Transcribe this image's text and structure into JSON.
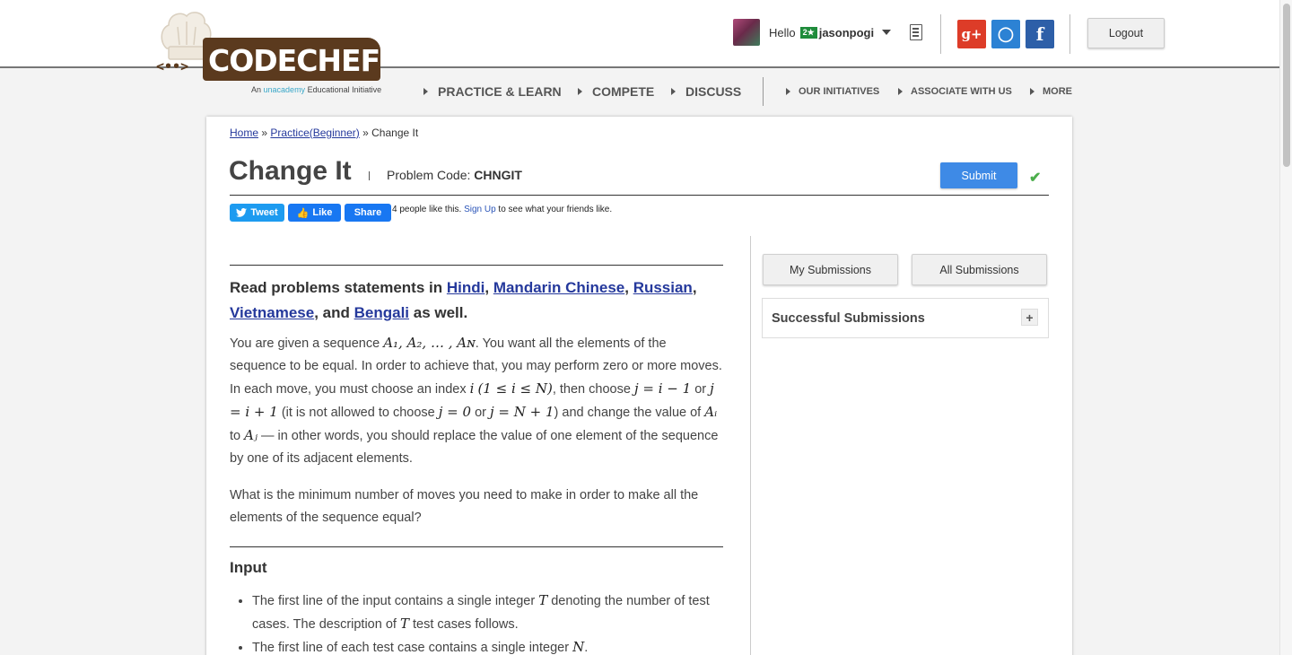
{
  "brand": {
    "name": "CODECHEF",
    "tagline_prefix": "An",
    "tagline_brand": "unacademy",
    "tagline_suffix": "Educational Initiative"
  },
  "user": {
    "greeting": "Hello",
    "rating_badge": "2★",
    "username": "jasonpogi"
  },
  "social": {
    "gplus": "g+",
    "github": "◯",
    "facebook": "f"
  },
  "header": {
    "logout_label": "Logout"
  },
  "nav": {
    "primary": [
      "PRACTICE & LEARN",
      "COMPETE",
      "DISCUSS"
    ],
    "secondary": [
      "OUR INITIATIVES",
      "ASSOCIATE WITH US",
      "MORE"
    ]
  },
  "breadcrumb": {
    "home": "Home",
    "sep1": "»",
    "practice": "Practice(Beginner)",
    "sep2": "»",
    "current": "Change It"
  },
  "problem": {
    "title": "Change It",
    "code_label": "Problem Code:",
    "code": "CHNGIT",
    "submit_label": "Submit"
  },
  "share": {
    "tweet": "Tweet",
    "like": "Like",
    "share": "Share",
    "like_text_pre": "4 people like this.",
    "signup": "Sign Up",
    "like_text_post": "to see what your friends like."
  },
  "languages": {
    "intro": "Read problems statements in",
    "items": [
      "Hindi",
      "Mandarin Chinese",
      "Russian",
      "Vietnamese",
      "Bengali"
    ],
    "outro": "as well."
  },
  "statement": {
    "p1": {
      "t1": "You are given a sequence",
      "m1": "A₁, A₂, … , Aɴ",
      "t2": ". You want all the elements of the sequence to be equal. In order to achieve that, you may perform zero or more moves. In each move, you must choose an index",
      "m2": "i",
      "m3": "(1 ≤ i ≤ N)",
      "t3": ", then choose",
      "m4": "j = i − 1",
      "t4": "or",
      "m5": "j = i + 1",
      "t5": "(it is not allowed to choose",
      "m6": "j = 0",
      "t6": "or",
      "m7": "j = N + 1",
      "t7": ") and change the value of",
      "m8": "Aᵢ",
      "t8": "to",
      "m9": "Aⱼ",
      "t9": "— in other words, you should replace the value of one element of the sequence by one of its adjacent elements."
    },
    "p2": "What is the minimum number of moves you need to make in order to make all the elements of the sequence equal?"
  },
  "input_section": {
    "heading": "Input",
    "items": [
      {
        "t1": "The first line of the input contains a single integer",
        "m": "T",
        "t2": "denoting the number of test cases. The description of",
        "m2": "T",
        "t3": "test cases follows."
      },
      {
        "t1": "The first line of each test case contains a single integer",
        "m": "N",
        "t2": "."
      }
    ]
  },
  "sidebar": {
    "my_submissions": "My Submissions",
    "all_submissions": "All Submissions",
    "successful_submissions": "Successful Submissions",
    "expand": "+"
  }
}
